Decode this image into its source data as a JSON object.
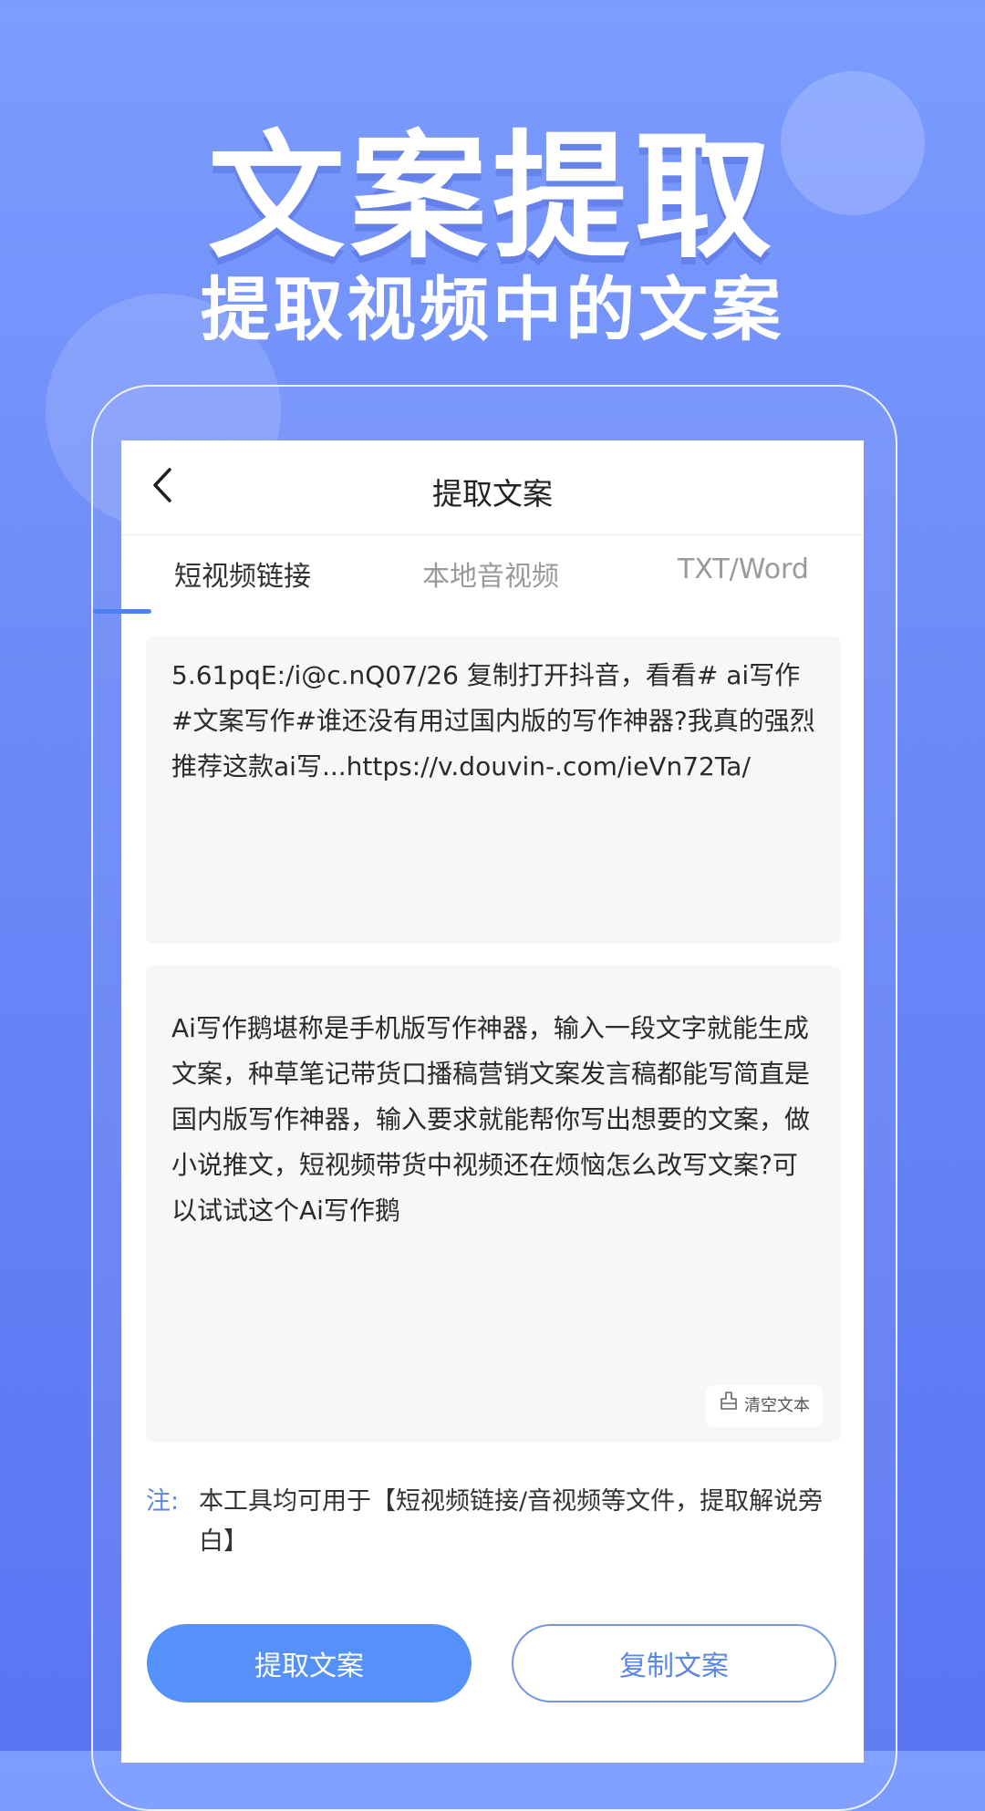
{
  "hero": {
    "title": "文案提取",
    "subtitle": "提取视频中的文案"
  },
  "nav": {
    "title": "提取文案",
    "back_icon": "chevron-left-icon"
  },
  "tabs": [
    {
      "label": "短视频链接",
      "active": true
    },
    {
      "label": "本地音视频",
      "active": false
    },
    {
      "label": "TXT/Word",
      "active": false
    }
  ],
  "input": {
    "value": "5.61pqE:/i@c.nQ07/26 复制打开抖音，看看# ai写作#文案写作#谁还没有用过国内版的写作神器?我真的强烈推荐这款ai写...https://v.douvin-.com/ieVn72Ta/"
  },
  "output": {
    "value": "Ai写作鹅堪称是手机版写作神器，输入一段文字就能生成文案，种草笔记带货口播稿营销文案发言稿都能写简直是国内版写作神器，输入要求就能帮你写出想要的文案，做小说推文，短视频带货中视频还在烦恼怎么改写文案?可以试试这个Ai写作鹅",
    "clear_label": "清空文本",
    "clear_icon": "broom-icon"
  },
  "note": {
    "label": "注:",
    "text": "本工具均可用于【短视频链接/音视频等文件，提取解说旁白】"
  },
  "actions": {
    "extract_label": "提取文案",
    "copy_label": "复制文案"
  },
  "colors": {
    "accent": "#5590fb",
    "tab_indicator": "#4e7ff5",
    "note_label": "#5a86e8"
  }
}
